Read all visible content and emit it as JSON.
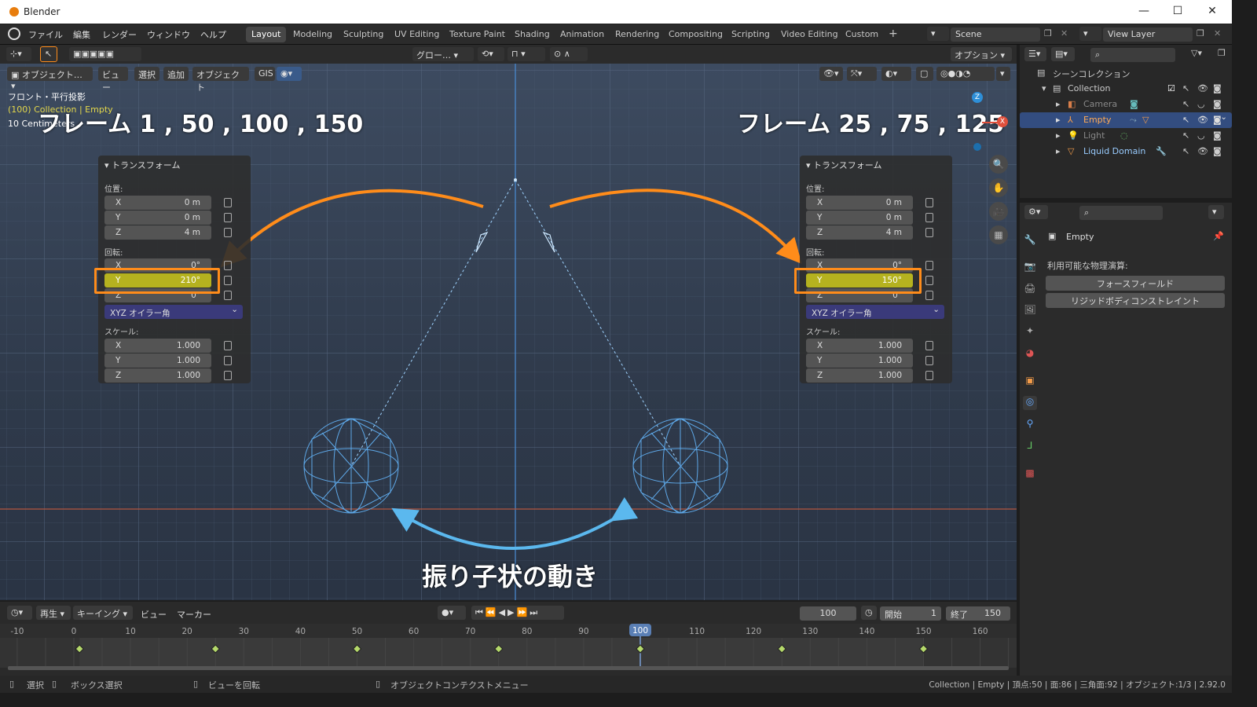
{
  "titlebar": {
    "title": "Blender",
    "min": "—",
    "max": "☐",
    "close": "✕"
  },
  "menu": [
    "ファイル",
    "編集",
    "レンダー",
    "ウィンドウ",
    "ヘルプ"
  ],
  "workspaces": [
    "Layout",
    "Modeling",
    "Sculpting",
    "UV Editing",
    "Texture Paint",
    "Shading",
    "Animation",
    "Rendering",
    "Compositing",
    "Scripting",
    "Video Editing",
    "Custom",
    "+"
  ],
  "scene": {
    "name": "Scene",
    "view_layer": "View Layer"
  },
  "tool_header": {
    "transform": "グロー…",
    "options": "オプション"
  },
  "viewport_header": {
    "mode": "オブジェクト…",
    "view": "ビュー",
    "select": "選択",
    "add": "追加",
    "object": "オブジェクト",
    "gis": "GIS"
  },
  "viewport": {
    "view_name": "フロント・平行投影",
    "object_info": "(100) Collection | Empty",
    "scale_info": "10 Centimeters",
    "left_caption": "フレーム 1 , 50 , 100 , 150",
    "right_caption": "フレーム 25 , 75 , 125",
    "bottom_caption": "振り子状の動き",
    "gizmo_z": "Z",
    "gizmo_x": "X"
  },
  "transform_left": {
    "header": "トランスフォーム",
    "location_label": "位置:",
    "loc": [
      {
        "a": "X",
        "v": "0 m"
      },
      {
        "a": "Y",
        "v": "0 m"
      },
      {
        "a": "Z",
        "v": "4 m"
      }
    ],
    "rotation_label": "回転:",
    "rot": [
      {
        "a": "X",
        "v": "0°"
      },
      {
        "a": "Y",
        "v": "210°"
      },
      {
        "a": "Z",
        "v": "0°"
      }
    ],
    "euler": "XYZ オイラー角",
    "scale_label": "スケール:",
    "scale": [
      {
        "a": "X",
        "v": "1.000"
      },
      {
        "a": "Y",
        "v": "1.000"
      },
      {
        "a": "Z",
        "v": "1.000"
      }
    ]
  },
  "transform_right": {
    "header": "トランスフォーム",
    "location_label": "位置:",
    "loc": [
      {
        "a": "X",
        "v": "0 m"
      },
      {
        "a": "Y",
        "v": "0 m"
      },
      {
        "a": "Z",
        "v": "4 m"
      }
    ],
    "rotation_label": "回転:",
    "rot": [
      {
        "a": "X",
        "v": "0°"
      },
      {
        "a": "Y",
        "v": "150°"
      },
      {
        "a": "Z",
        "v": "0°"
      }
    ],
    "euler": "XYZ オイラー角",
    "scale_label": "スケール:",
    "scale": [
      {
        "a": "X",
        "v": "1.000"
      },
      {
        "a": "Y",
        "v": "1.000"
      },
      {
        "a": "Z",
        "v": "1.000"
      }
    ]
  },
  "outliner": {
    "root": "シーンコレクション",
    "collection": "Collection",
    "items": [
      "Camera",
      "Empty",
      "Light",
      "Liquid Domain"
    ]
  },
  "properties": {
    "object_name": "Empty",
    "physics_label": "利用可能な物理演算:",
    "btn_force": "フォースフィールド",
    "btn_rigid": "リジッドボディコンストレイント"
  },
  "timeline": {
    "play": "再生",
    "keying": "キーイング",
    "view": "ビュー",
    "marker": "マーカー",
    "current_frame": "100",
    "start_label": "開始",
    "start": "1",
    "end_label": "終了",
    "end": "150",
    "ticks": [
      "-10",
      "0",
      "10",
      "20",
      "30",
      "40",
      "50",
      "60",
      "70",
      "80",
      "90",
      "100",
      "110",
      "120",
      "130",
      "140",
      "150",
      "160"
    ],
    "keyframes": [
      1,
      25,
      50,
      75,
      100,
      125,
      150
    ]
  },
  "status": {
    "select": "選択",
    "box_select": "ボックス選択",
    "rotate_view": "ビューを回転",
    "context_menu": "オブジェクトコンテクストメニュー",
    "stats": "Collection | Empty | 頂点:50 | 面:86 | 三角面:92 | オブジェクト:1/3 | 2.92.0"
  },
  "colors": {
    "accent_orange": "#ff8c1a",
    "accent_blue": "#5bb8ee",
    "highlight_field": "#b5b21f",
    "selected_row": "#334d80"
  }
}
